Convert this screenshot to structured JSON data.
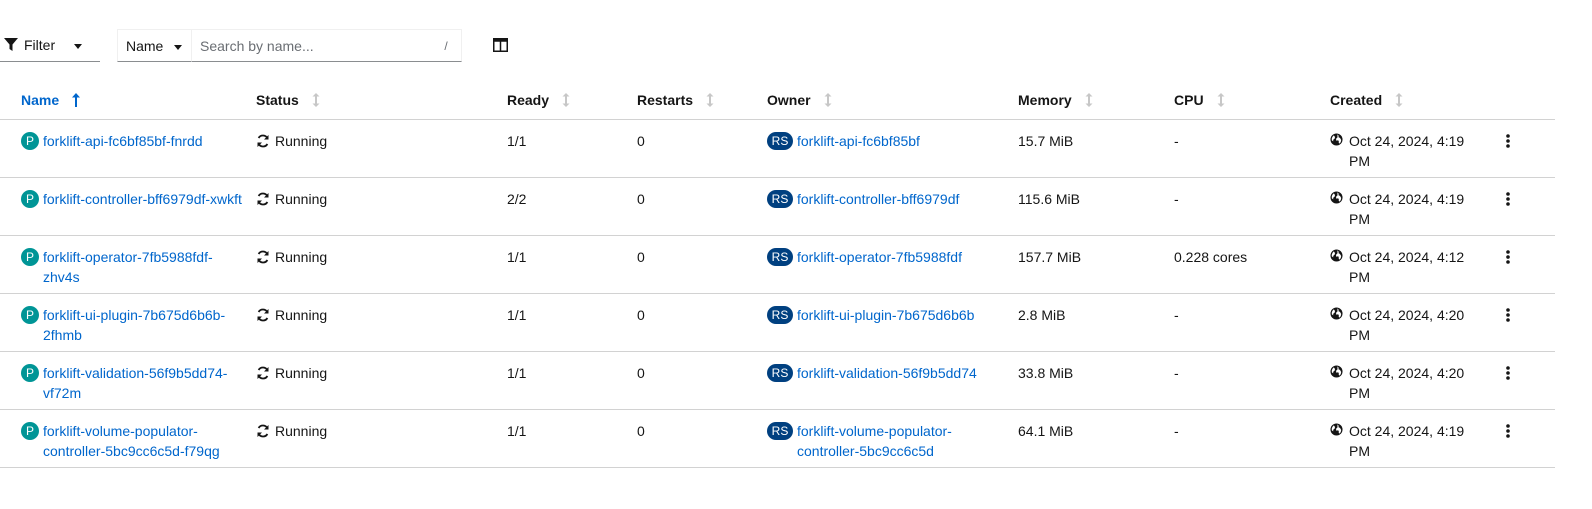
{
  "toolbar": {
    "filter_label": "Filter",
    "name_select_value": "Name",
    "search_placeholder": "Search by name...",
    "search_shortcut": "/"
  },
  "columns": {
    "name": "Name",
    "status": "Status",
    "ready": "Ready",
    "restarts": "Restarts",
    "owner": "Owner",
    "memory": "Memory",
    "cpu": "CPU",
    "created": "Created"
  },
  "badges": {
    "pod": "P",
    "replicaset": "RS"
  },
  "rows": [
    {
      "name": "forklift-api-fc6bf85bf-fnrdd",
      "status": "Running",
      "ready": "1/1",
      "restarts": "0",
      "owner": "forklift-api-fc6bf85bf",
      "memory": "15.7 MiB",
      "cpu": "-",
      "created": "Oct 24, 2024, 4:19 PM"
    },
    {
      "name": "forklift-controller-bff6979df-xwkft",
      "status": "Running",
      "ready": "2/2",
      "restarts": "0",
      "owner": "forklift-controller-bff6979df",
      "memory": "115.6 MiB",
      "cpu": "-",
      "created": "Oct 24, 2024, 4:19 PM"
    },
    {
      "name": "forklift-operator-7fb5988fdf-zhv4s",
      "status": "Running",
      "ready": "1/1",
      "restarts": "0",
      "owner": "forklift-operator-7fb5988fdf",
      "memory": "157.7 MiB",
      "cpu": "0.228 cores",
      "created": "Oct 24, 2024, 4:12 PM"
    },
    {
      "name": "forklift-ui-plugin-7b675d6b6b-2fhmb",
      "status": "Running",
      "ready": "1/1",
      "restarts": "0",
      "owner": "forklift-ui-plugin-7b675d6b6b",
      "memory": "2.8 MiB",
      "cpu": "-",
      "created": "Oct 24, 2024, 4:20 PM"
    },
    {
      "name": "forklift-validation-56f9b5dd74-vf72m",
      "status": "Running",
      "ready": "1/1",
      "restarts": "0",
      "owner": "forklift-validation-56f9b5dd74",
      "memory": "33.8 MiB",
      "cpu": "-",
      "created": "Oct 24, 2024, 4:20 PM"
    },
    {
      "name": "forklift-volume-populator-controller-5bc9cc6c5d-f79qg",
      "status": "Running",
      "ready": "1/1",
      "restarts": "0",
      "owner": "forklift-volume-populator-controller-5bc9cc6c5d",
      "memory": "64.1 MiB",
      "cpu": "-",
      "created": "Oct 24, 2024, 4:19 PM"
    }
  ],
  "colors": {
    "link": "#0066cc",
    "pod_badge": "#009596",
    "replicaset_badge": "#004080",
    "border": "#d2d2d2"
  },
  "icons": {
    "filter": "filter-icon",
    "columns": "columns-icon",
    "sort": "sort-icon",
    "status": "sync-icon",
    "created": "globe-icon",
    "actions": "kebab-icon"
  }
}
